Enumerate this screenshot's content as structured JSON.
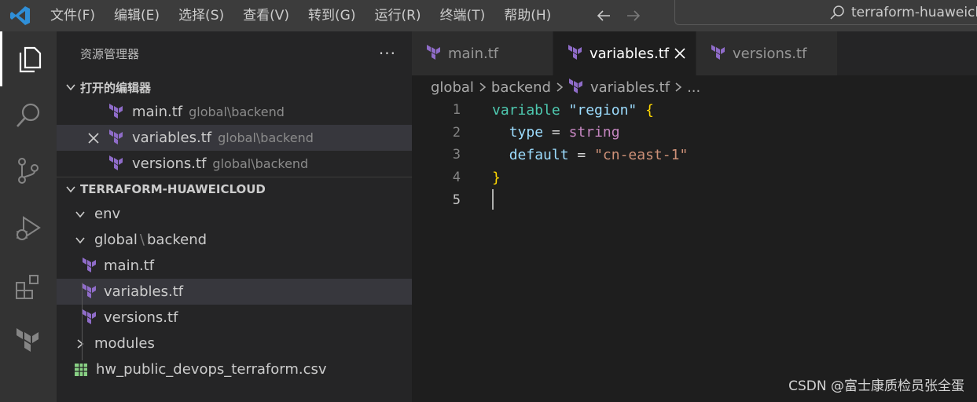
{
  "titlebar": {
    "menu": [
      "文件(F)",
      "编辑(E)",
      "选择(S)",
      "查看(V)",
      "转到(G)",
      "运行(R)",
      "终端(T)",
      "帮助(H)"
    ],
    "search_text": "terraform-huaweiclo"
  },
  "sidebar": {
    "title": "资源管理器",
    "more": "···",
    "open_editors": {
      "header": "打开的编辑器",
      "items": [
        {
          "name": "main.tf",
          "desc": "global\\backend"
        },
        {
          "name": "variables.tf",
          "desc": "global\\backend"
        },
        {
          "name": "versions.tf",
          "desc": "global\\backend"
        }
      ]
    },
    "explorer": {
      "header": "TERRAFORM-HUAWEICLOUD",
      "env": "env",
      "global": "global",
      "backend": "backend",
      "sep": "\\",
      "files": [
        "main.tf",
        "variables.tf",
        "versions.tf"
      ],
      "modules": "modules",
      "csv": "hw_public_devops_terraform.csv"
    }
  },
  "editor": {
    "tabs": [
      "main.tf",
      "variables.tf",
      "versions.tf"
    ],
    "breadcrumb": {
      "p1": "global",
      "p2": "backend",
      "p3": "variables.tf",
      "p4": "..."
    },
    "line_numbers": [
      "1",
      "2",
      "3",
      "4",
      "5"
    ],
    "code": {
      "l1_kw": "variable",
      "l1_str": "\"region\"",
      "l1_brace": "{",
      "l2_attr": "type",
      "l2_eq": "=",
      "l2_val": "string",
      "l3_attr": "default",
      "l3_eq": "=",
      "l3_val": "\"cn-east-1\"",
      "l4_brace": "}"
    }
  },
  "watermark": "CSDN @富士康质检员张全蛋",
  "colors": {
    "terraform": "#8f6cc9",
    "keyword": "#4ec9b0",
    "string": "#9cdcfe",
    "value": "#ce9178",
    "type": "#c586c0",
    "brace": "#ffd700"
  }
}
